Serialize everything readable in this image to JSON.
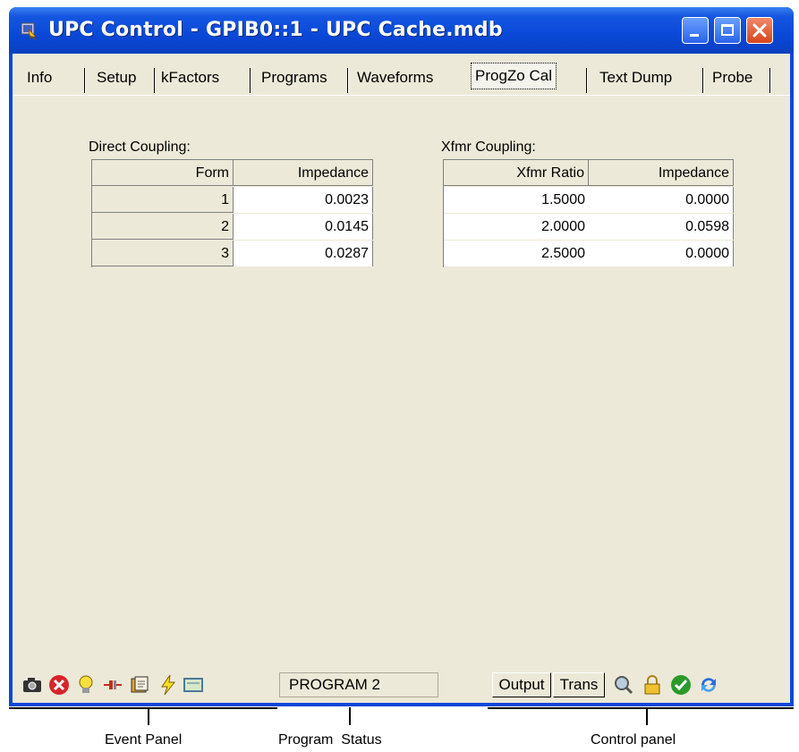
{
  "window": {
    "title": "UPC Control - GPIB0::1 - UPC Cache.mdb",
    "controls": {
      "minimize": "minimize",
      "maximize": "maximize",
      "close": "close"
    }
  },
  "tabs": [
    {
      "label": "Info"
    },
    {
      "label": "Setup"
    },
    {
      "label": "kFactors"
    },
    {
      "label": "Programs"
    },
    {
      "label": "Waveforms"
    },
    {
      "label": "ProgZo Cal",
      "active": true
    },
    {
      "label": "Text Dump"
    },
    {
      "label": "Probe"
    }
  ],
  "direct": {
    "label": "Direct Coupling:",
    "columns": [
      "Form",
      "Impedance"
    ],
    "rows": [
      {
        "form": "1",
        "impedance": "0.0023"
      },
      {
        "form": "2",
        "impedance": "0.0145"
      },
      {
        "form": "3",
        "impedance": "0.0287"
      }
    ]
  },
  "xfmr": {
    "label": "Xfmr Coupling:",
    "columns": [
      "Xfmr Ratio",
      "Impedance"
    ],
    "rows": [
      {
        "ratio": "1.5000",
        "impedance": "0.0000"
      },
      {
        "ratio": "2.0000",
        "impedance": "0.0598"
      },
      {
        "ratio": "2.5000",
        "impedance": "0.0000"
      }
    ]
  },
  "statusbar": {
    "event_icons": [
      "camera-icon",
      "error-icon",
      "lightbulb-icon",
      "plug-icon",
      "folder-icon",
      "lightning-icon",
      "panel-icon"
    ],
    "program_status": "PROGRAM 2",
    "control_buttons": {
      "output": "Output",
      "trans": "Trans"
    },
    "control_icons": [
      "magnifier-icon",
      "lock-icon",
      "check-icon",
      "refresh-icon"
    ]
  },
  "annotations": {
    "event_panel": "Event Panel",
    "program_status": "Program  Status",
    "control_panel": "Control panel"
  },
  "colors": {
    "titlebar": "#0a48d8",
    "client": "#ece9d8",
    "close": "#d8441c"
  }
}
